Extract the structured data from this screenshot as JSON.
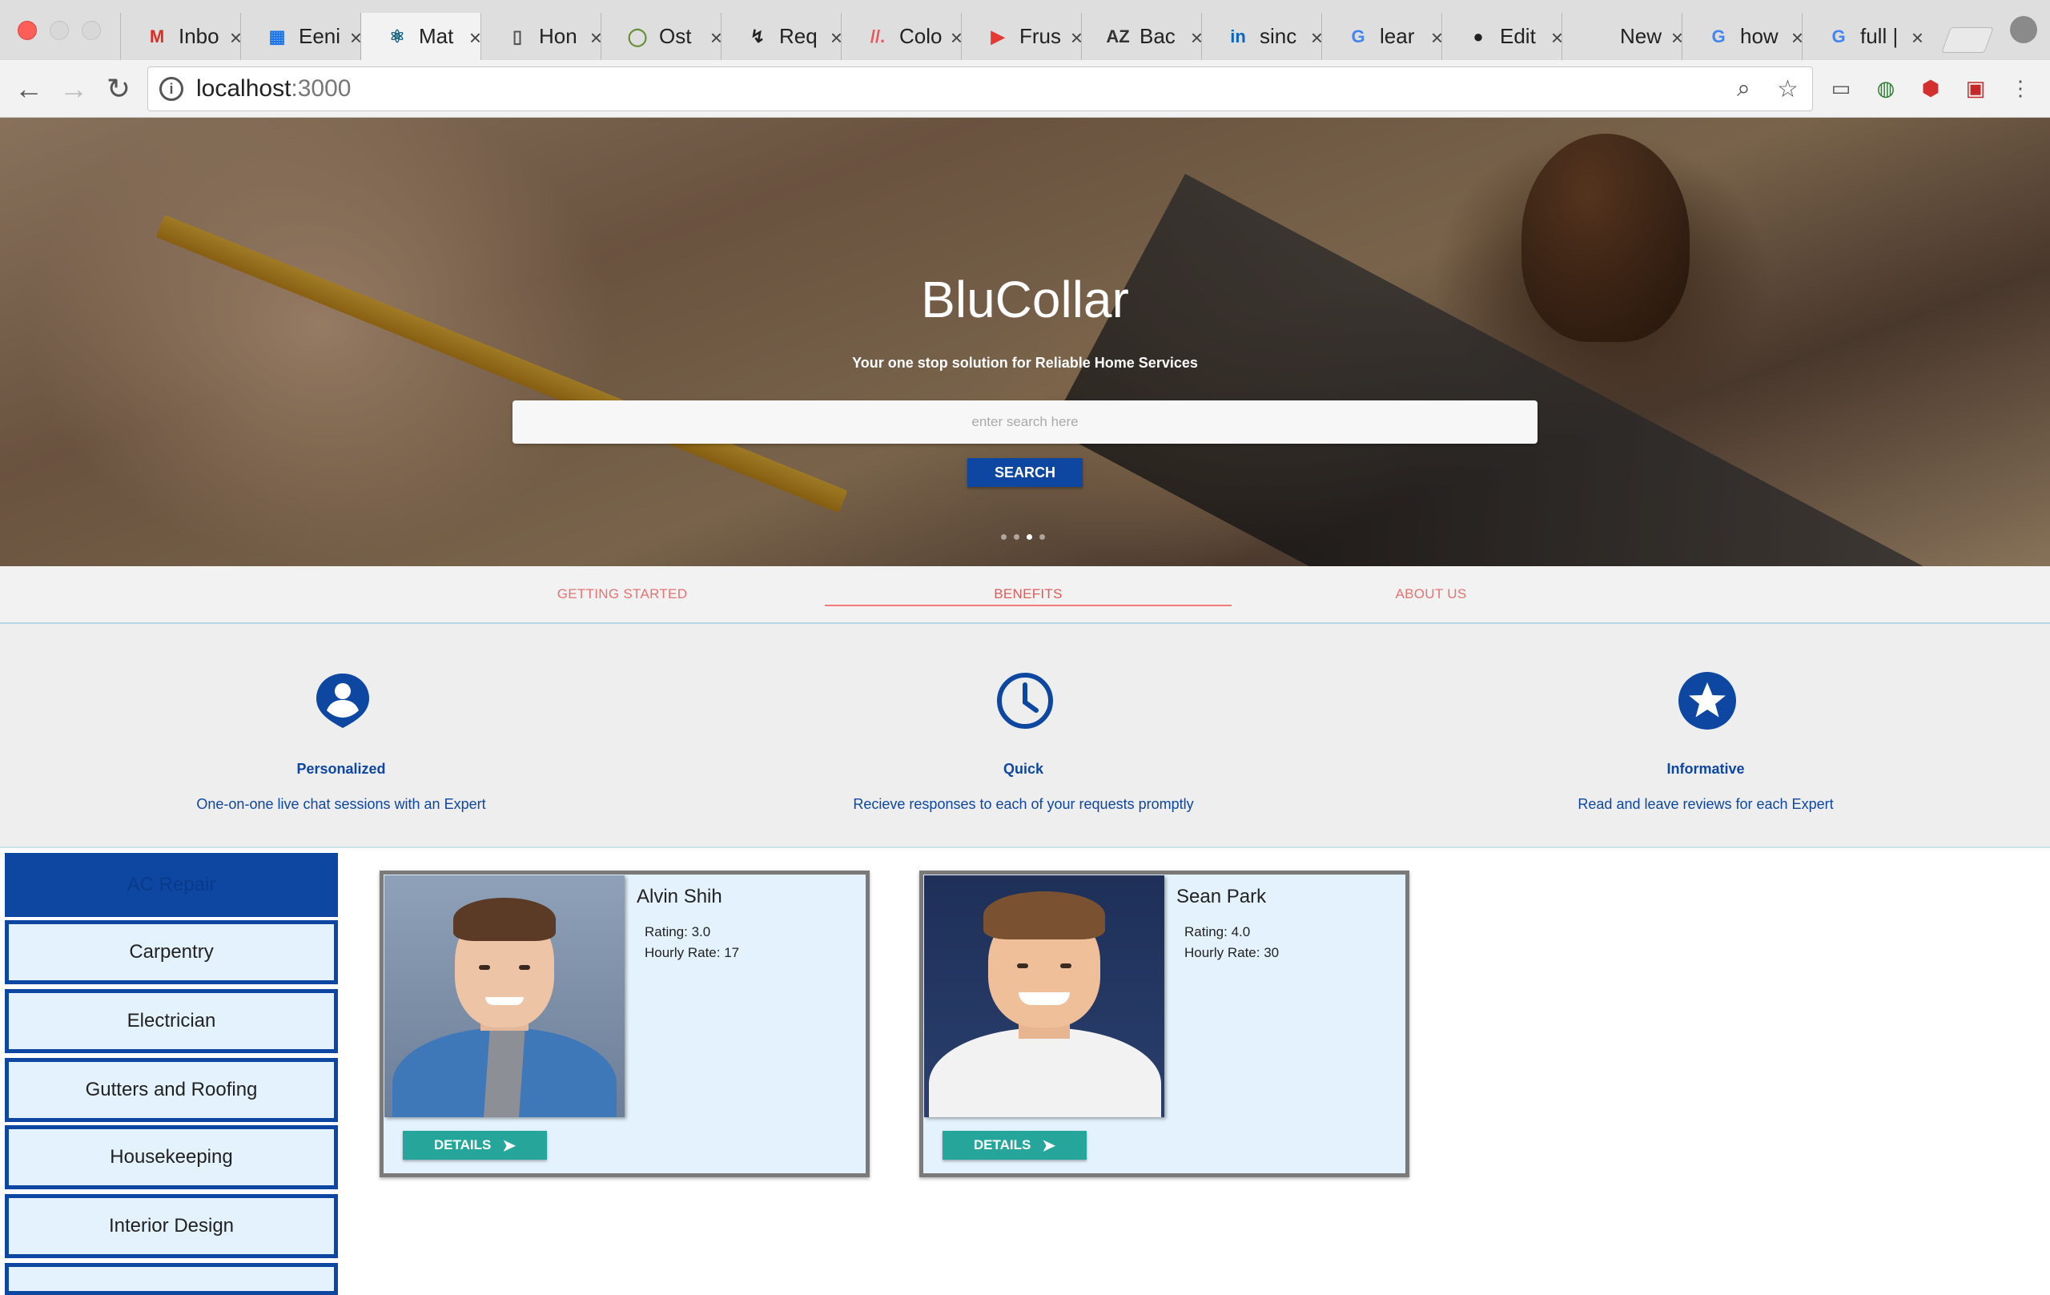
{
  "browser": {
    "tabs": [
      {
        "label": "Inbo",
        "icon": "M",
        "color": "#d93025"
      },
      {
        "label": "Eeni",
        "icon": "▦",
        "color": "#1a73e8"
      },
      {
        "label": "Mat",
        "icon": "⚛",
        "color": "#0b5d7a"
      },
      {
        "label": "Hon",
        "icon": "▯",
        "color": "#555555"
      },
      {
        "label": "Ost",
        "icon": "◯",
        "color": "#6a8f3a"
      },
      {
        "label": "Req",
        "icon": "↯",
        "color": "#222222"
      },
      {
        "label": "Colo",
        "icon": "//.",
        "color": "#e8555b"
      },
      {
        "label": "Frus",
        "icon": "▶",
        "color": "#e53935"
      },
      {
        "label": "Bac",
        "icon": "AZ",
        "color": "#333333"
      },
      {
        "label": "sinc",
        "icon": "in",
        "color": "#0a66c2"
      },
      {
        "label": "lear",
        "icon": "G",
        "color": "#4285f4"
      },
      {
        "label": "Edit",
        "icon": "●",
        "color": "#222222"
      },
      {
        "label": "New Ta",
        "icon": "",
        "color": "#222222"
      },
      {
        "label": "how",
        "icon": "G",
        "color": "#4285f4"
      },
      {
        "label": "full |",
        "icon": "G",
        "color": "#4285f4"
      }
    ],
    "close_glyph": "×",
    "url_host": "localhost",
    "url_port": ":3000"
  },
  "hero": {
    "title": "BluCollar",
    "subtitle": "Your one stop solution for Reliable Home Services",
    "search_placeholder": "enter search here",
    "search_button": "SEARCH",
    "slide_count": 4,
    "active_slide": 3
  },
  "section_tabs": [
    {
      "label": "GETTING STARTED"
    },
    {
      "label": "BENEFITS",
      "active": true
    },
    {
      "label": "ABOUT US"
    }
  ],
  "benefits": [
    {
      "icon": "person-pin-icon",
      "title": "Personalized",
      "description": "One-on-one live chat sessions with an Expert"
    },
    {
      "icon": "clock-icon",
      "title": "Quick",
      "description": "Recieve responses to each of your requests promptly"
    },
    {
      "icon": "star-circle-icon",
      "title": "Informative",
      "description": "Read and leave reviews for each Expert"
    }
  ],
  "categories": [
    {
      "label": "AC Repair",
      "active": true
    },
    {
      "label": "Carpentry"
    },
    {
      "label": "Electrician"
    },
    {
      "label": "Gutters and Roofing"
    },
    {
      "label": "Housekeeping"
    },
    {
      "label": "Interior Design"
    }
  ],
  "experts": [
    {
      "name": "Alvin Shih",
      "rating": "Rating: 3.0",
      "hourly_rate": "Hourly Rate: 17",
      "button": "DETAILS"
    },
    {
      "name": "Sean Park",
      "rating": "Rating: 4.0",
      "hourly_rate": "Hourly Rate: 30",
      "button": "DETAILS"
    }
  ],
  "colors": {
    "primary": "#0d47a1",
    "accent": "#26a69a",
    "tab_text": "#e57373",
    "card_bg": "#e3f2fd"
  }
}
